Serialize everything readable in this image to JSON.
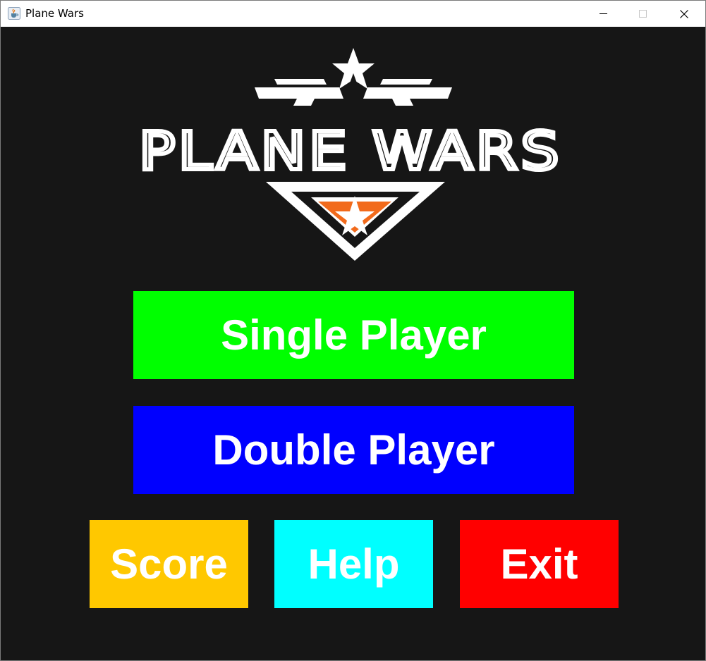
{
  "window": {
    "title": "Plane Wars",
    "app_icon": "java-cup-icon",
    "controls": [
      "minimize-icon",
      "maximize-icon",
      "close-icon"
    ]
  },
  "logo": {
    "text": "PLANE WARS",
    "colors": {
      "primary": "#ffffff",
      "accent": "#f26a1b"
    }
  },
  "menu": {
    "single_player": {
      "label": "Single Player",
      "color": "#00ff00"
    },
    "double_player": {
      "label": "Double Player",
      "color": "#0000ff"
    },
    "score": {
      "label": "Score",
      "color": "#ffc800"
    },
    "help": {
      "label": "Help",
      "color": "#00ffff"
    },
    "exit": {
      "label": "Exit",
      "color": "#ff0000"
    }
  },
  "colors": {
    "background": "#161616",
    "button_text": "#ffffff"
  }
}
